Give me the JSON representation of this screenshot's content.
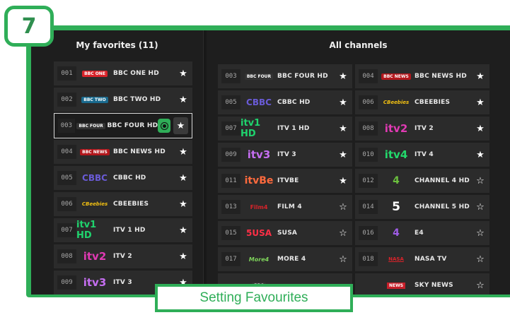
{
  "step_number": "7",
  "caption": "Setting Favourites",
  "colors": {
    "accent": "#2fae58",
    "background": "#1e1e1e",
    "row": "#2b2b2b"
  },
  "favorites": {
    "title": "My favorites (11)",
    "items": [
      {
        "num": "001",
        "logo": "BBC ONE",
        "name": "BBC ONE HD",
        "star": "★"
      },
      {
        "num": "002",
        "logo": "BBC TWO",
        "name": "BBC TWO HD",
        "star": "★"
      },
      {
        "num": "003",
        "logo": "BBC FOUR",
        "name": "BBC FOUR HD",
        "star": "★"
      },
      {
        "num": "004",
        "logo": "BBC NEWS",
        "name": "BBC NEWS HD",
        "star": "★"
      },
      {
        "num": "005",
        "logo": "CBBC",
        "name": "CBBC HD",
        "star": "★"
      },
      {
        "num": "006",
        "logo": "CBeebies",
        "name": "CBEEBIES",
        "star": "★"
      },
      {
        "num": "007",
        "logo": "itv1 HD",
        "name": "ITV 1 HD",
        "star": "★"
      },
      {
        "num": "008",
        "logo": "itv2",
        "name": "ITV 2",
        "star": "★"
      },
      {
        "num": "009",
        "logo": "itv3",
        "name": "ITV 3",
        "star": "★"
      }
    ]
  },
  "all_channels": {
    "title": "All channels",
    "items": [
      {
        "num": "003",
        "logo": "BBC FOUR",
        "name": "BBC FOUR HD",
        "star": "★"
      },
      {
        "num": "004",
        "logo": "BBC NEWS",
        "name": "BBC NEWS HD",
        "star": "★"
      },
      {
        "num": "005",
        "logo": "CBBC",
        "name": "CBBC HD",
        "star": "★"
      },
      {
        "num": "006",
        "logo": "CBeebies",
        "name": "CBEEBIES",
        "star": "★"
      },
      {
        "num": "007",
        "logo": "itv1 HD",
        "name": "ITV 1 HD",
        "star": "★"
      },
      {
        "num": "008",
        "logo": "itv2",
        "name": "ITV 2",
        "star": "★"
      },
      {
        "num": "009",
        "logo": "itv3",
        "name": "ITV 3",
        "star": "★"
      },
      {
        "num": "010",
        "logo": "itv4",
        "name": "ITV 4",
        "star": "★"
      },
      {
        "num": "011",
        "logo": "itvBe",
        "name": "ITVBE",
        "star": "★"
      },
      {
        "num": "012",
        "logo": "4",
        "name": "CHANNEL 4 HD",
        "star": "☆"
      },
      {
        "num": "013",
        "logo": "Film4",
        "name": "FILM 4",
        "star": "☆"
      },
      {
        "num": "014",
        "logo": "5",
        "name": "CHANNEL 5 HD",
        "star": "☆"
      },
      {
        "num": "015",
        "logo": "5USA",
        "name": "SUSA",
        "star": "☆"
      },
      {
        "num": "016",
        "logo": "4",
        "name": "E4",
        "star": "☆"
      },
      {
        "num": "017",
        "logo": "More4",
        "name": "MORE 4",
        "star": "☆"
      },
      {
        "num": "018",
        "logo": "NASA",
        "name": "NASA TV",
        "star": "☆"
      },
      {
        "num": "",
        "logo": "BBC",
        "name": "",
        "star": ""
      },
      {
        "num": "",
        "logo": "NEWS",
        "name": "SKY NEWS",
        "star": "☆"
      }
    ]
  }
}
